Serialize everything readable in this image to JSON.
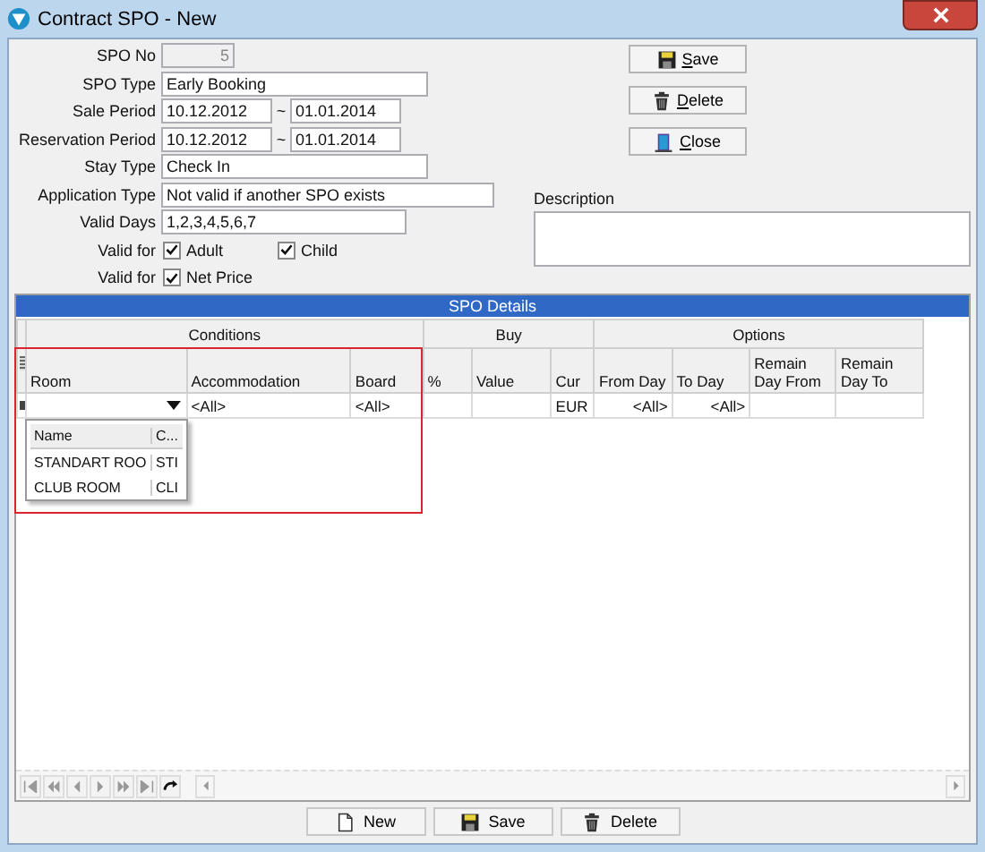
{
  "window": {
    "title": "Contract SPO - New"
  },
  "form": {
    "fields": [
      {
        "kind": "readonly",
        "label": "SPO No",
        "value": "5"
      },
      {
        "kind": "text",
        "label": "SPO Type",
        "value": "Early Booking"
      },
      {
        "kind": "range",
        "label": "Sale Period",
        "from": "10.12.2012",
        "sep": "~",
        "to": "01.01.2014"
      },
      {
        "kind": "range",
        "label": "Reservation Period",
        "from": "10.12.2012",
        "sep": "~",
        "to": "01.01.2014"
      },
      {
        "kind": "text",
        "label": "Stay Type",
        "value": "Check In"
      },
      {
        "kind": "text",
        "label": "Application Type",
        "value": "Not valid if another SPO exists"
      },
      {
        "kind": "text",
        "label": "Valid Days",
        "value": "1,2,3,4,5,6,7"
      },
      {
        "kind": "checks",
        "label": "Valid for",
        "options": [
          {
            "label": "Adult",
            "checked": true
          },
          {
            "label": "Child",
            "checked": true
          }
        ]
      },
      {
        "kind": "checks",
        "label": "Valid for",
        "options": [
          {
            "label": "Net Price",
            "checked": true
          }
        ]
      }
    ],
    "side_buttons": [
      {
        "label": "Save"
      },
      {
        "label": "Delete"
      },
      {
        "label": "Close"
      }
    ],
    "description": {
      "label": "Description"
    }
  },
  "details": {
    "title": "SPO Details",
    "groups": [
      {
        "label": "Conditions"
      },
      {
        "label": "Buy"
      },
      {
        "label": "Options"
      }
    ],
    "columns": [
      "Room",
      "Accommodation",
      "Board",
      "%",
      "Value",
      "Cur",
      "From Day",
      "To Day",
      "Remain Day From",
      "Remain Day To"
    ],
    "rows": [
      {
        "cells": [
          "",
          "<All>",
          "<All>",
          "",
          "",
          "EUR",
          "<All>",
          "<All>",
          "",
          ""
        ],
        "editing": true
      }
    ],
    "dropdown": {
      "columns": [
        "Name",
        "C..."
      ],
      "rows": [
        [
          "STANDART ROO",
          "STI"
        ],
        [
          "CLUB ROOM",
          "CLI"
        ]
      ]
    },
    "highlighted": true
  },
  "footer_buttons": [
    {
      "label": "New"
    },
    {
      "label": "Save"
    },
    {
      "label": "Delete"
    }
  ]
}
